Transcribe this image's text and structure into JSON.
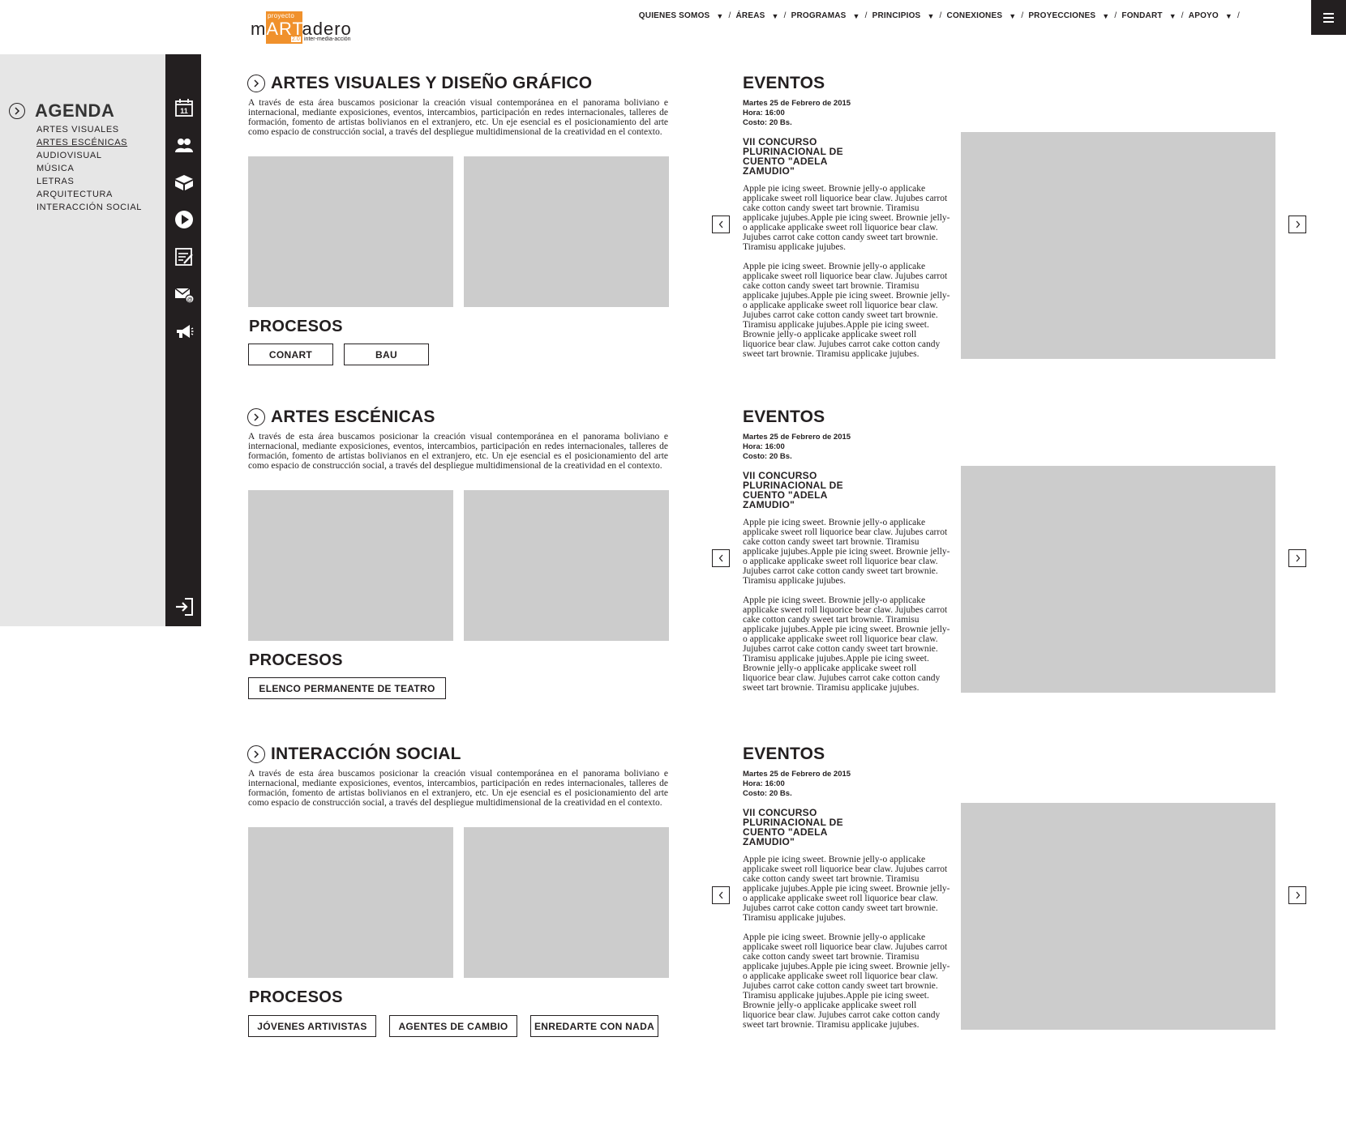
{
  "header": {
    "logo": {
      "top": "proyecto",
      "word_pre": "m",
      "word_art": "ART",
      "word_post": "adero",
      "version": "2.0",
      "tagline": "inter-media-acción"
    },
    "nav": [
      {
        "label": "QUIENES SOMOS"
      },
      {
        "label": "ÁREAS"
      },
      {
        "label": "PROGRAMAS"
      },
      {
        "label": "PRINCIPIOS"
      },
      {
        "label": "CONEXIONES"
      },
      {
        "label": "PROYECCIONES"
      },
      {
        "label": "FONDART"
      },
      {
        "label": "APOYO"
      }
    ],
    "nav_separator": "/",
    "nav_arrow": "▼",
    "menu_icon": "hamburger-icon"
  },
  "sidebar": {
    "title": "AGENDA",
    "links": [
      {
        "label": "ARTES VISUALES",
        "active": false
      },
      {
        "label": "ARTES ESCÉNICAS",
        "active": true
      },
      {
        "label": "AUDIOVISUAL",
        "active": false
      },
      {
        "label": "MÚSICA",
        "active": false
      },
      {
        "label": "LETRAS",
        "active": false
      },
      {
        "label": "ARQUITECTURA",
        "active": false
      },
      {
        "label": "INTERACCIÓN SOCIAL",
        "active": false
      }
    ],
    "icons": [
      "calendar-icon",
      "people-icon",
      "box-icon",
      "play-icon",
      "notes-icon",
      "mail-icon",
      "megaphone-icon",
      "logout-icon"
    ],
    "calendar_day": "11"
  },
  "sections": [
    {
      "title": "ARTES VISUALES Y DISEÑO GRÁFICO",
      "description": "A través de esta área buscamos posicionar la creación visual contemporánea en el panorama boliviano e internacional, mediante exposiciones, eventos, intercambios, participación en redes internacionales, talleres de formación, fomento de artistas bolivianos en el extranjero, etc. Un eje esencial es el posicionamiento del arte como espacio de construcción social, a través del despliegue multidimensional de la creatividad en el contexto.",
      "procesos_title": "PROCESOS",
      "procesos": [
        "CONART",
        "BAU"
      ],
      "event": {
        "title": "EVENTOS",
        "date": "Martes 25 de Febrero de 2015",
        "time": "Hora: 16:00",
        "cost": "Costo: 20 Bs.",
        "name": "VII CONCURSO PLURINACIONAL DE CUENTO \"ADELA ZAMUDIO\"",
        "paragraph1": "Apple pie icing sweet. Brownie jelly-o applicake applicake sweet roll liquorice bear claw. Jujubes carrot cake cotton candy sweet tart brownie. Tiramisu applicake jujubes.Apple pie icing sweet. Brownie jelly-o applicake applicake sweet roll liquorice bear claw. Jujubes carrot cake cotton candy sweet tart brownie. Tiramisu applicake jujubes.",
        "paragraph2": "Apple pie icing sweet. Brownie jelly-o applicake applicake sweet roll liquorice bear claw. Jujubes carrot cake cotton candy sweet tart brownie. Tiramisu applicake jujubes.Apple pie icing sweet. Brownie jelly-o applicake applicake sweet roll liquorice bear claw. Jujubes carrot cake cotton candy sweet tart brownie. Tiramisu applicake jujubes.Apple pie icing sweet. Brownie jelly-o applicake applicake sweet roll liquorice bear claw. Jujubes carrot cake cotton candy sweet tart brownie. Tiramisu applicake jujubes."
      }
    },
    {
      "title": "ARTES ESCÉNICAS",
      "description": "A través de esta área buscamos posicionar la creación visual contemporánea en el panorama boliviano e internacional, mediante exposiciones, eventos, intercambios, participación en redes internacionales, talleres de formación, fomento de artistas bolivianos en el extranjero, etc. Un eje esencial es el posicionamiento del arte como espacio de construcción social, a través del despliegue multidimensional de la creatividad en el contexto.",
      "procesos_title": "PROCESOS",
      "procesos": [
        "ELENCO PERMANENTE DE TEATRO"
      ],
      "event": {
        "title": "EVENTOS",
        "date": "Martes 25 de Febrero de 2015",
        "time": "Hora: 16:00",
        "cost": "Costo: 20 Bs.",
        "name": "VII CONCURSO PLURINACIONAL DE CUENTO \"ADELA ZAMUDIO\"",
        "paragraph1": "Apple pie icing sweet. Brownie jelly-o applicake applicake sweet roll liquorice bear claw. Jujubes carrot cake cotton candy sweet tart brownie. Tiramisu applicake jujubes.Apple pie icing sweet. Brownie jelly-o applicake applicake sweet roll liquorice bear claw. Jujubes carrot cake cotton candy sweet tart brownie. Tiramisu applicake jujubes.",
        "paragraph2": "Apple pie icing sweet. Brownie jelly-o applicake applicake sweet roll liquorice bear claw. Jujubes carrot cake cotton candy sweet tart brownie. Tiramisu applicake jujubes.Apple pie icing sweet. Brownie jelly-o applicake applicake sweet roll liquorice bear claw. Jujubes carrot cake cotton candy sweet tart brownie. Tiramisu applicake jujubes.Apple pie icing sweet. Brownie jelly-o applicake applicake sweet roll liquorice bear claw. Jujubes carrot cake cotton candy sweet tart brownie. Tiramisu applicake jujubes."
      }
    },
    {
      "title": "INTERACCIÓN SOCIAL",
      "description": "A través de esta área buscamos posicionar la creación visual contemporánea en el panorama boliviano e internacional, mediante exposiciones, eventos, intercambios, participación en redes internacionales, talleres de formación, fomento de artistas bolivianos en el extranjero, etc. Un eje esencial es el posicionamiento del arte como espacio de construcción social, a través del despliegue multidimensional de la creatividad en el contexto.",
      "procesos_title": "PROCESOS",
      "procesos": [
        "JÓVENES ARTIVISTAS",
        "AGENTES DE CAMBIO",
        "ENREDARTE CON NADA"
      ],
      "event": {
        "title": "EVENTOS",
        "date": "Martes 25 de Febrero de 2015",
        "time": "Hora: 16:00",
        "cost": "Costo: 20 Bs.",
        "name": "VII CONCURSO PLURINACIONAL DE CUENTO \"ADELA ZAMUDIO\"",
        "paragraph1": "Apple pie icing sweet. Brownie jelly-o applicake applicake sweet roll liquorice bear claw. Jujubes carrot cake cotton candy sweet tart brownie. Tiramisu applicake jujubes.Apple pie icing sweet. Brownie jelly-o applicake applicake sweet roll liquorice bear claw. Jujubes carrot cake cotton candy sweet tart brownie. Tiramisu applicake jujubes.",
        "paragraph2": "Apple pie icing sweet. Brownie jelly-o applicake applicake sweet roll liquorice bear claw. Jujubes carrot cake cotton candy sweet tart brownie. Tiramisu applicake jujubes.Apple pie icing sweet. Brownie jelly-o applicake applicake sweet roll liquorice bear claw. Jujubes carrot cake cotton candy sweet tart brownie. Tiramisu applicake jujubes.Apple pie icing sweet. Brownie jelly-o applicake applicake sweet roll liquorice bear claw. Jujubes carrot cake cotton candy sweet tart brownie. Tiramisu applicake jujubes."
      }
    }
  ],
  "colors": {
    "dark": "#231f20",
    "sidebar_bg": "#e6e6e6",
    "placeholder": "#cccccc",
    "accent": "#f0912c"
  }
}
